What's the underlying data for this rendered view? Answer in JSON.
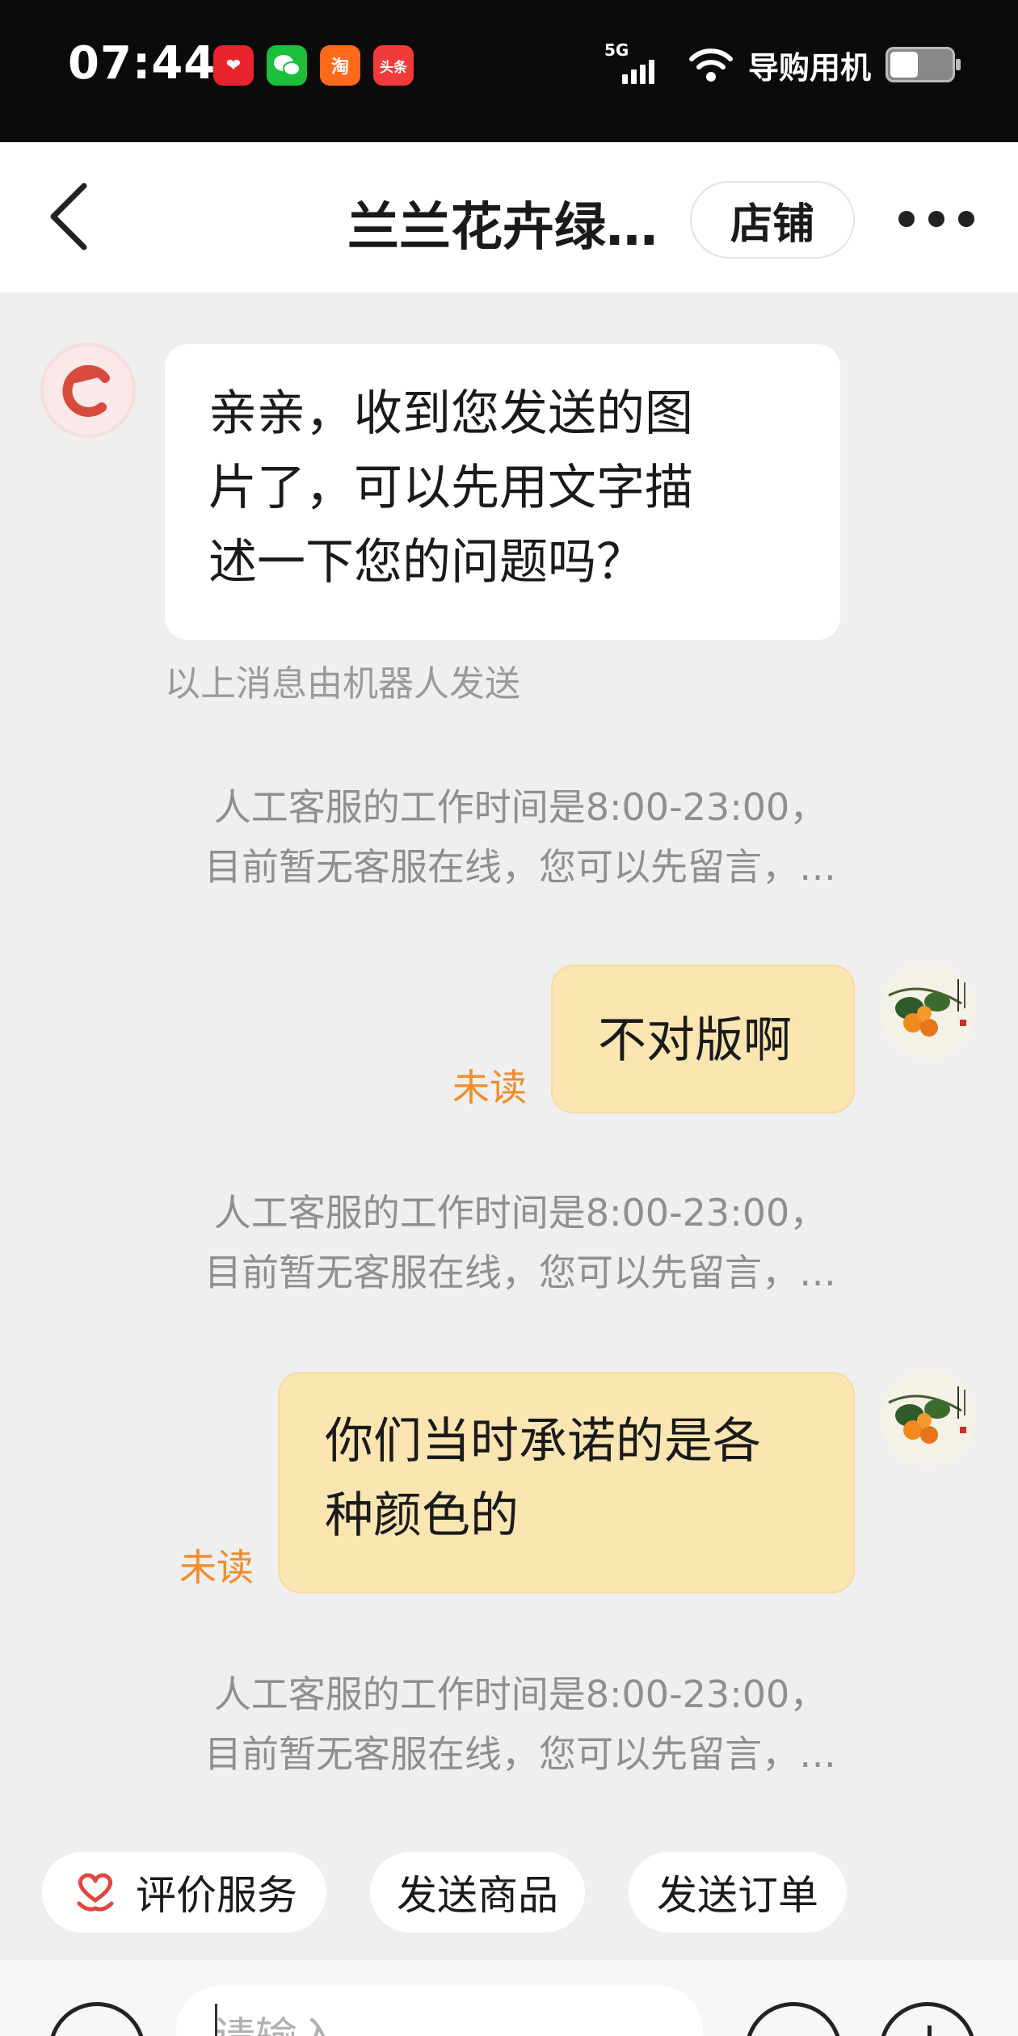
{
  "status_bar": {
    "time": "07:44",
    "network": "5G",
    "carrier_label": "导购用机",
    "apps": [
      {
        "name": "pinduoduo-icon",
        "glyph": "❤"
      },
      {
        "name": "wechat-icon",
        "glyph": "●"
      },
      {
        "name": "taobao-icon",
        "glyph": "淘"
      },
      {
        "name": "toutiao-icon",
        "glyph": "头条"
      }
    ]
  },
  "header": {
    "title": "兰兰花卉绿…",
    "store_button": "店铺"
  },
  "messages": {
    "bot_reply": {
      "lines": [
        "亲亲，收到您发送的图",
        "片了，可以先用文字描",
        "述一下您的问题吗？"
      ]
    },
    "robot_note": "以上消息由机器人发送",
    "system_notices": [
      {
        "line1": "人工客服的工作时间是8:00-23:00，",
        "line2": "目前暂无客服在线，您可以先留言，…"
      },
      {
        "line1": "人工客服的工作时间是8:00-23:00，",
        "line2": "目前暂无客服在线，您可以先留言，…"
      },
      {
        "line1": "人工客服的工作时间是8:00-23:00，",
        "line2": "目前暂无客服在线，您可以先留言，…"
      }
    ],
    "user_messages": [
      {
        "lines": [
          "不对版啊"
        ],
        "status": "未读"
      },
      {
        "lines": [
          "你们当时承诺的是各",
          "种颜色的"
        ],
        "status": "未读"
      }
    ]
  },
  "quick_actions": {
    "rate_service": "评价服务",
    "send_product": "发送商品",
    "send_order": "发送订单"
  },
  "composer": {
    "placeholder": "请输入"
  },
  "colors": {
    "unread": "#f08c2c",
    "user_bubble": "#fbe6b2",
    "chat_background": "#efefef",
    "accent_red": "#e0473f"
  }
}
